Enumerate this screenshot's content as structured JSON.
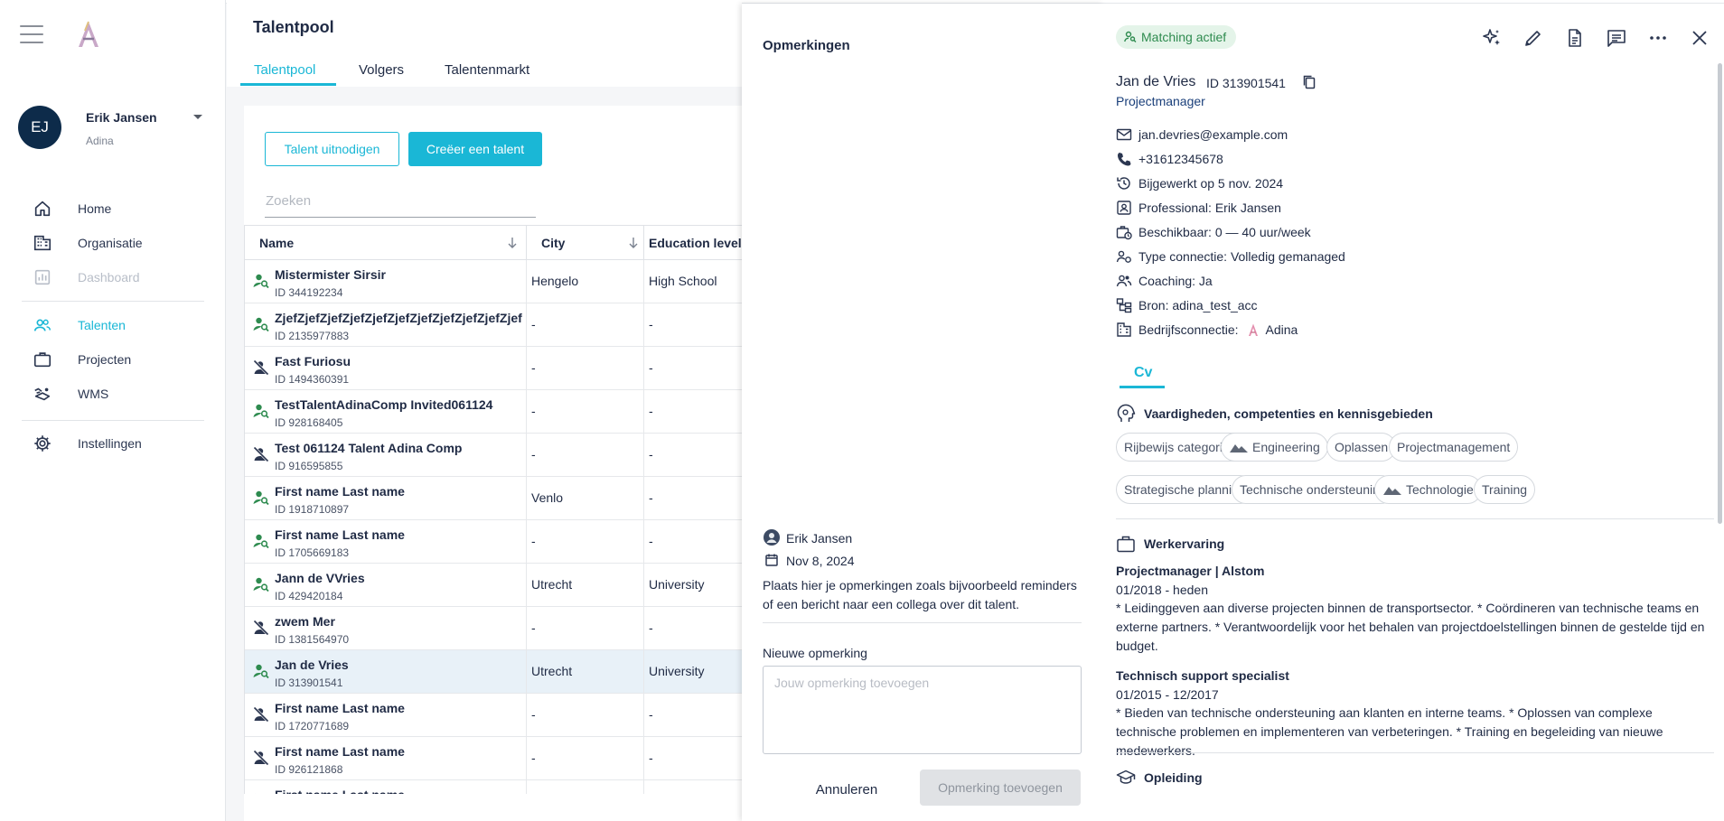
{
  "sidebar": {
    "user": {
      "initials": "EJ",
      "name": "Erik Jansen",
      "org": "Adina"
    },
    "nav": [
      {
        "label": "Home"
      },
      {
        "label": "Organisatie"
      },
      {
        "label": "Dashboard"
      },
      {
        "label": "Talenten"
      },
      {
        "label": "Projecten"
      },
      {
        "label": "WMS"
      },
      {
        "label": "Instellingen"
      }
    ],
    "accent_color": "#1ab7d6"
  },
  "main": {
    "title": "Talentpool",
    "tabs": [
      {
        "label": "Talentpool"
      },
      {
        "label": "Volgers"
      },
      {
        "label": "Talentenmarkt"
      }
    ],
    "invite_button": "Talent uitnodigen",
    "create_button": "Creëer een talent",
    "search_placeholder": "Zoeken",
    "columns": [
      "Name",
      "City",
      "Education level"
    ],
    "rows": [
      {
        "name": "Mistermister Sirsir",
        "id": "ID 344192234",
        "city": "Hengelo",
        "education": "High School",
        "matching": true
      },
      {
        "name": "ZjefZjefZjefZjefZjefZjefZjefZjefZjefZjefZjef",
        "id": "ID 2135977883",
        "city": "-",
        "education": "-",
        "matching": true
      },
      {
        "name": "Fast Furiosu",
        "id": "ID 1494360391",
        "city": "-",
        "education": "-",
        "matching": false
      },
      {
        "name": "TestTalentAdinaComp Invited061124",
        "id": "ID 928168405",
        "city": "-",
        "education": "-",
        "matching": true
      },
      {
        "name": "Test 061124 Talent Adina Comp",
        "id": "ID 916595855",
        "city": "-",
        "education": "-",
        "matching": false
      },
      {
        "name": "First name Last name",
        "id": "ID 1918710897",
        "city": "Venlo",
        "education": "-",
        "matching": true
      },
      {
        "name": "First name Last name",
        "id": "ID 1705669183",
        "city": "-",
        "education": "-",
        "matching": true
      },
      {
        "name": "Jann de VVries",
        "id": "ID 429420184",
        "city": "Utrecht",
        "education": "University",
        "matching": true
      },
      {
        "name": "zwem Mer",
        "id": "ID 1381564970",
        "city": "-",
        "education": "-",
        "matching": false
      },
      {
        "name": "Jan de Vries",
        "id": "ID 313901541",
        "city": "Utrecht",
        "education": "University",
        "matching": true,
        "selected": true
      },
      {
        "name": "First name Last name",
        "id": "ID 1720771689",
        "city": "-",
        "education": "-",
        "matching": false
      },
      {
        "name": "First name Last name",
        "id": "ID 926121868",
        "city": "-",
        "education": "-",
        "matching": false
      },
      {
        "name": "First name Last name",
        "id": "",
        "city": "",
        "education": "",
        "matching": false
      }
    ]
  },
  "remarks": {
    "title": "Opmerkingen",
    "author": "Erik Jansen",
    "date": "Nov 8, 2024",
    "text": "Plaats hier je opmerkingen zoals bijvoorbeeld reminders of een bericht naar een collega over dit talent.",
    "new_label": "Nieuwe opmerking",
    "placeholder": "Jouw opmerking toevoegen",
    "cancel": "Annuleren",
    "submit": "Opmerking toevoegen"
  },
  "detail": {
    "badge": "Matching actief",
    "name": "Jan de Vries",
    "id": "ID 313901541",
    "role": "Projectmanager",
    "info": [
      {
        "icon": "mail-icon",
        "text": "jan.devries@example.com"
      },
      {
        "icon": "phone-icon",
        "text": "+31612345678"
      },
      {
        "icon": "history-icon",
        "text": "Bijgewerkt op 5 nov. 2024"
      },
      {
        "icon": "id-card-icon",
        "text": "Professional: Erik Jansen"
      },
      {
        "icon": "briefcase-clock-icon",
        "text": "Beschikbaar: 0 — 40 uur/week"
      },
      {
        "icon": "connection-icon",
        "text": "Type connectie: Volledig gemanaged"
      },
      {
        "icon": "coaching-icon",
        "text": "Coaching: Ja"
      },
      {
        "icon": "source-icon",
        "text": "Bron: adina_test_acc"
      },
      {
        "icon": "building-icon",
        "text": "Bedrijfsconnectie:",
        "suffix": "Adina"
      }
    ],
    "cv_tab": "Cv",
    "skills_title": "Vaardigheden, competenties en kennisgebieden",
    "skills": [
      {
        "label": "Rijbewijs categorie B",
        "icon": false
      },
      {
        "label": "Engineering",
        "icon": true
      },
      {
        "label": "Oplassen",
        "icon": false
      },
      {
        "label": "Projectmanagement",
        "icon": false
      },
      {
        "label": "Strategische planning",
        "icon": false
      },
      {
        "label": "Technische ondersteuning",
        "icon": false
      },
      {
        "label": "Technologie",
        "icon": true
      },
      {
        "label": "Training",
        "icon": false
      }
    ],
    "work_title": "Werkervaring",
    "work": [
      {
        "title": "Projectmanager | Alstom",
        "period": "01/2018 - heden",
        "desc": "* Leidinggeven aan diverse projecten binnen de transportsector. * Coördineren van technische teams en externe partners. * Verantwoordelijk voor het behalen van projectdoelstellingen binnen de gestelde tijd en budget."
      },
      {
        "title": "Technisch support specialist",
        "period": "01/2015 - 12/2017",
        "desc": "* Bieden van technische ondersteuning aan klanten en interne teams. * Oplossen van complexe technische problemen en implementeren van verbeteringen. * Training en begeleiding van nieuwe medewerkers."
      }
    ],
    "education_title": "Opleiding",
    "colors": {
      "badge_bg": "#e4f4e9",
      "badge_text": "#2e8b4f",
      "role_text": "#1a3f7a"
    }
  }
}
